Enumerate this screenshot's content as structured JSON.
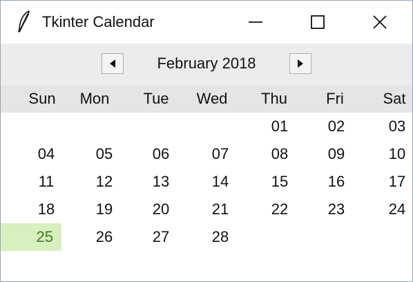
{
  "window": {
    "title": "Tkinter Calendar",
    "icon": "feather-icon",
    "controls": [
      "minimize-icon",
      "maximize-icon",
      "close-icon"
    ]
  },
  "header": {
    "month_year": "February 2018",
    "prev_icon": "triangle-left-icon",
    "next_icon": "triangle-right-icon"
  },
  "weekdays": [
    "Sun",
    "Mon",
    "Tue",
    "Wed",
    "Thu",
    "Fri",
    "Sat"
  ],
  "weeks": [
    [
      "",
      "",
      "",
      "",
      "01",
      "02",
      "03"
    ],
    [
      "04",
      "05",
      "06",
      "07",
      "08",
      "09",
      "10"
    ],
    [
      "11",
      "12",
      "13",
      "14",
      "15",
      "16",
      "17"
    ],
    [
      "18",
      "19",
      "20",
      "21",
      "22",
      "23",
      "24"
    ],
    [
      "25",
      "26",
      "27",
      "28",
      "",
      "",
      ""
    ]
  ],
  "selected_day": "25",
  "colors": {
    "selected_bg": "#d8f0c0",
    "selected_text": "#3a7d1a"
  }
}
